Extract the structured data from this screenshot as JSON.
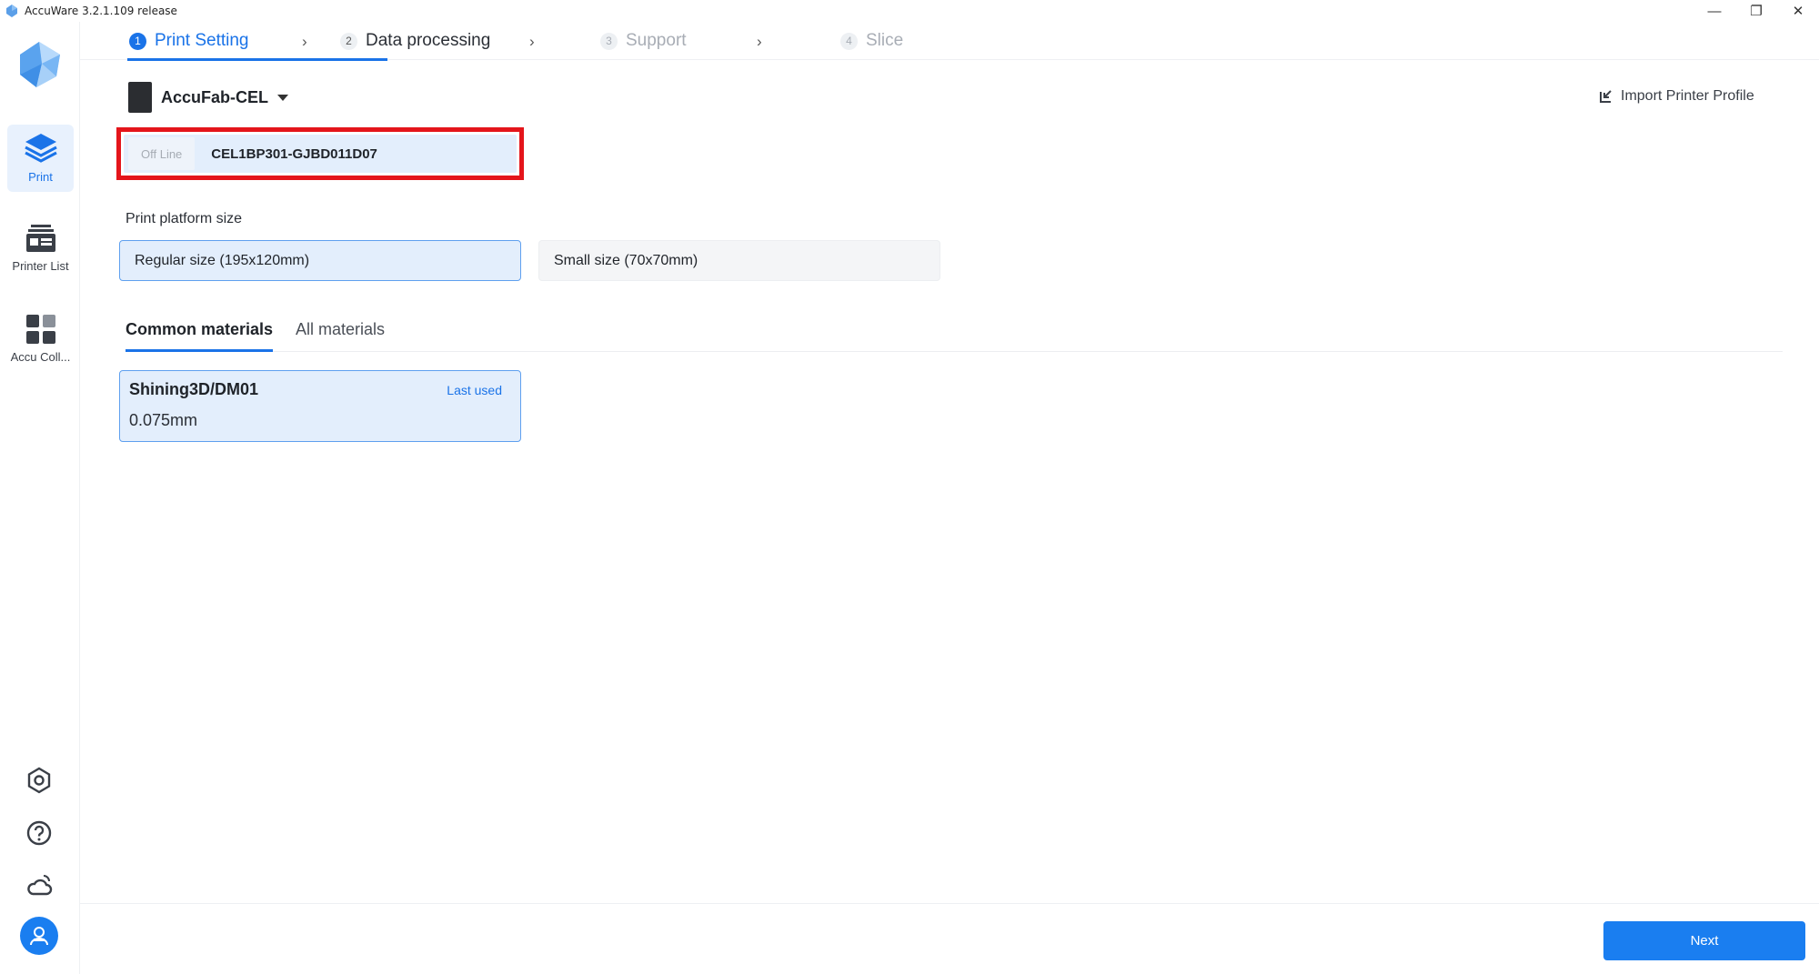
{
  "window": {
    "title": "AccuWare 3.2.1.109 release",
    "controls": {
      "minimize": "—",
      "restore": "❐",
      "close": "✕"
    }
  },
  "sidebar": {
    "items": [
      {
        "label": "Print",
        "icon": "layers-icon",
        "active": true
      },
      {
        "label": "Printer List",
        "icon": "printer-list-icon",
        "active": false
      },
      {
        "label": "Accu Coll...",
        "icon": "grid-apps-icon",
        "active": false
      }
    ],
    "bottom_icons": [
      "settings-icon",
      "help-icon",
      "cloud-icon",
      "user-avatar-icon"
    ]
  },
  "steps": [
    {
      "num": "1",
      "label": "Print Setting",
      "state": "active"
    },
    {
      "num": "2",
      "label": "Data processing",
      "state": "normal"
    },
    {
      "num": "3",
      "label": "Support",
      "state": "disabled"
    },
    {
      "num": "4",
      "label": "Slice",
      "state": "disabled"
    }
  ],
  "printer": {
    "name": "AccuFab-CEL",
    "status": "Off Line",
    "device_id": "CEL1BP301-GJBD011D07"
  },
  "import_label": "Import Printer Profile",
  "platform": {
    "label": "Print platform size",
    "options": [
      {
        "label": "Regular size (195x120mm)",
        "selected": true
      },
      {
        "label": "Small size (70x70mm)",
        "selected": false
      }
    ]
  },
  "material_tabs": {
    "tabs": [
      "Common materials",
      "All materials"
    ],
    "active": "Common materials"
  },
  "materials": [
    {
      "name": "Shining3D/DM01",
      "badge": "Last used",
      "thickness": "0.075mm"
    }
  ],
  "footer": {
    "next_label": "Next"
  },
  "colors": {
    "accent": "#1a73e8",
    "selected_bg": "#e3eefc",
    "highlight_border": "#e4151b"
  }
}
